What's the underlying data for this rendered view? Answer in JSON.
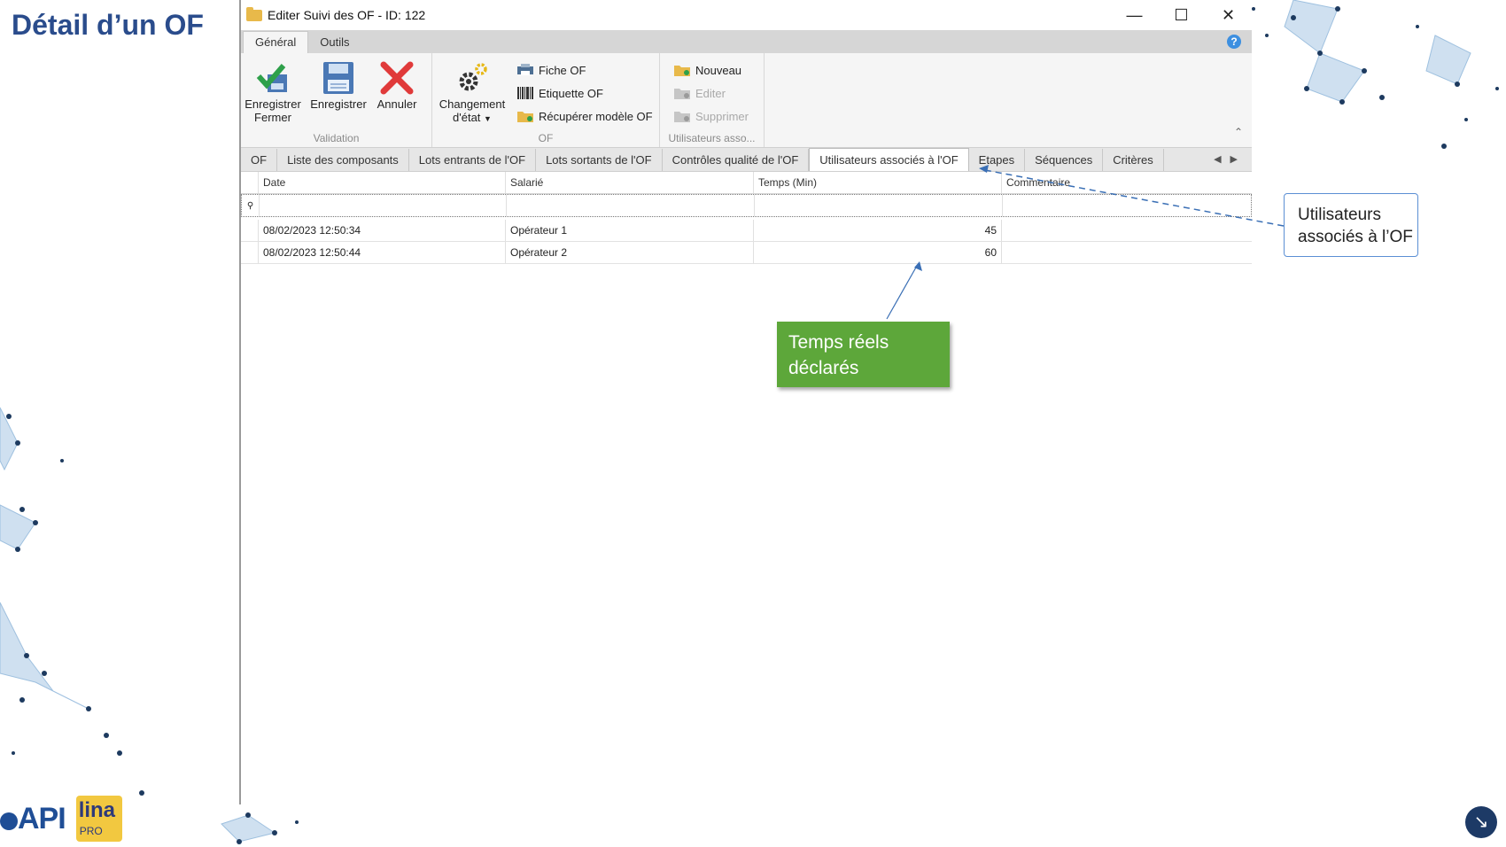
{
  "slide": {
    "title": "Détail d’un OF"
  },
  "window": {
    "title": "Editer Suivi des OF - ID: 122",
    "min_icon": "minimize-icon",
    "max_icon": "maximize-icon",
    "close_icon": "close-icon"
  },
  "ribbon": {
    "tabs": [
      "Général",
      "Outils"
    ],
    "active_tab": "Général",
    "groups": {
      "validation": {
        "label": "Validation",
        "buttons": [
          {
            "label1": "Enregistrer",
            "label2": "Fermer",
            "icon": "save-close-icon"
          },
          {
            "label1": "Enregistrer",
            "label2": "",
            "icon": "save-icon"
          },
          {
            "label1": "Annuler",
            "label2": "",
            "icon": "cancel-icon"
          }
        ]
      },
      "of": {
        "label": "OF",
        "change_state": {
          "label1": "Changement",
          "label2": "d'état",
          "icon": "gear-icon"
        },
        "items": [
          {
            "label": "Fiche OF",
            "icon": "printer-icon"
          },
          {
            "label": "Etiquette OF",
            "icon": "barcode-icon"
          },
          {
            "label": "Récupérer modèle OF",
            "icon": "folder-icon"
          }
        ]
      },
      "users": {
        "label": "Utilisateurs asso...",
        "items": [
          {
            "label": "Nouveau",
            "icon": "folder-add-icon",
            "disabled": false
          },
          {
            "label": "Editer",
            "icon": "edit-icon",
            "disabled": true
          },
          {
            "label": "Supprimer",
            "icon": "delete-icon",
            "disabled": true
          }
        ]
      }
    }
  },
  "doc_tabs": [
    "OF",
    "Liste des composants",
    "Lots entrants de l'OF",
    "Lots sortants de l'OF",
    "Contrôles qualité de l'OF",
    "Utilisateurs associés à l'OF",
    "Etapes",
    "Séquences",
    "Critères"
  ],
  "active_doc_tab": "Utilisateurs associés à l'OF",
  "grid": {
    "columns": [
      "Date",
      "Salarié",
      "Temps (Min)",
      "Commentaire"
    ],
    "rows": [
      [
        "08/02/2023 12:50:34",
        "Opérateur 1",
        "45",
        ""
      ],
      [
        "08/02/2023 12:50:44",
        "Opérateur 2",
        "60",
        ""
      ]
    ]
  },
  "callouts": {
    "users": {
      "line1": "Utilisateurs",
      "line2": "associés à l’OF"
    },
    "times": {
      "line1": "Temps réels",
      "line2": "déclarés"
    }
  },
  "logos": {
    "api": "API",
    "lina": "lina",
    "lina_sub": "PRO"
  },
  "colors": {
    "title": "#2a4c8c",
    "callout_green": "#5da73a",
    "callout_border": "#5b8fd4"
  }
}
